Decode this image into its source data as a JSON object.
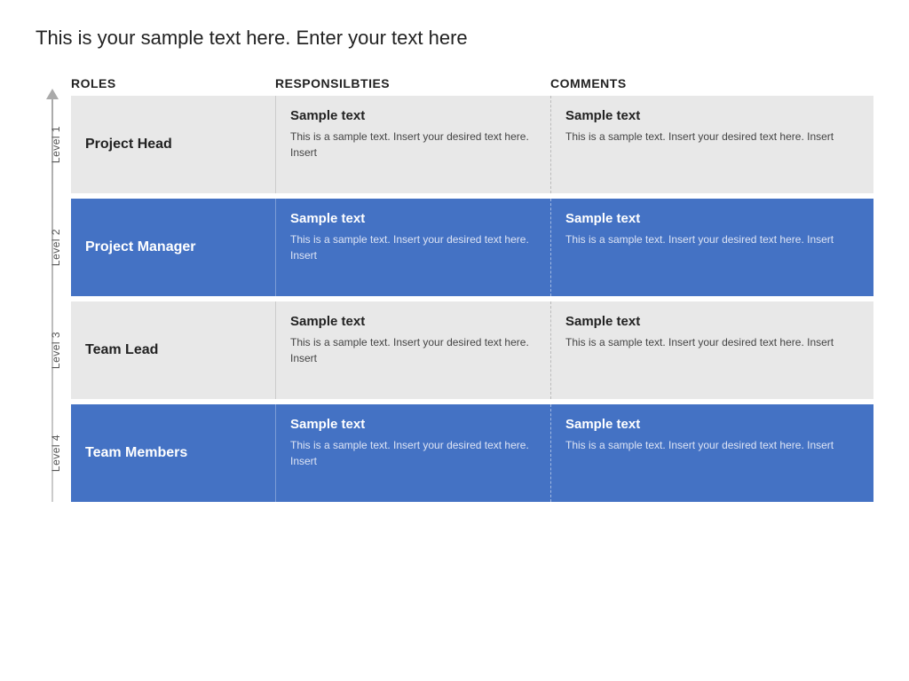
{
  "page": {
    "title": "This is your sample text here. Enter your text here"
  },
  "header": {
    "col_roles": "ROLES",
    "col_responsibilities": "RESPONSILBTIES",
    "col_comments": "COMMENTS"
  },
  "rows": [
    {
      "level": "Level 1",
      "role": "Project Head",
      "style": "light",
      "responsibilities_title": "Sample text",
      "responsibilities_body": "This is a sample text. Insert your desired text here. Insert",
      "comments_title": "Sample text",
      "comments_body": "This is a sample text. Insert your desired text here. Insert"
    },
    {
      "level": "Level 2",
      "role": "Project Manager",
      "style": "blue",
      "responsibilities_title": "Sample text",
      "responsibilities_body": "This is a sample text. Insert your desired text here. Insert",
      "comments_title": "Sample text",
      "comments_body": "This is a sample text. Insert your desired text here. Insert"
    },
    {
      "level": "Level 3",
      "role": "Team Lead",
      "style": "light",
      "responsibilities_title": "Sample text",
      "responsibilities_body": "This is a sample text. Insert your desired text here. Insert",
      "comments_title": "Sample text",
      "comments_body": "This is a sample text. Insert your desired text here. Insert"
    },
    {
      "level": "Level 4",
      "role": "Team Members",
      "style": "blue",
      "responsibilities_title": "Sample text",
      "responsibilities_body": "This is a sample text. Insert your desired text here. Insert",
      "comments_title": "Sample text",
      "comments_body": "This is a sample text. Insert your desired text here. Insert"
    }
  ]
}
